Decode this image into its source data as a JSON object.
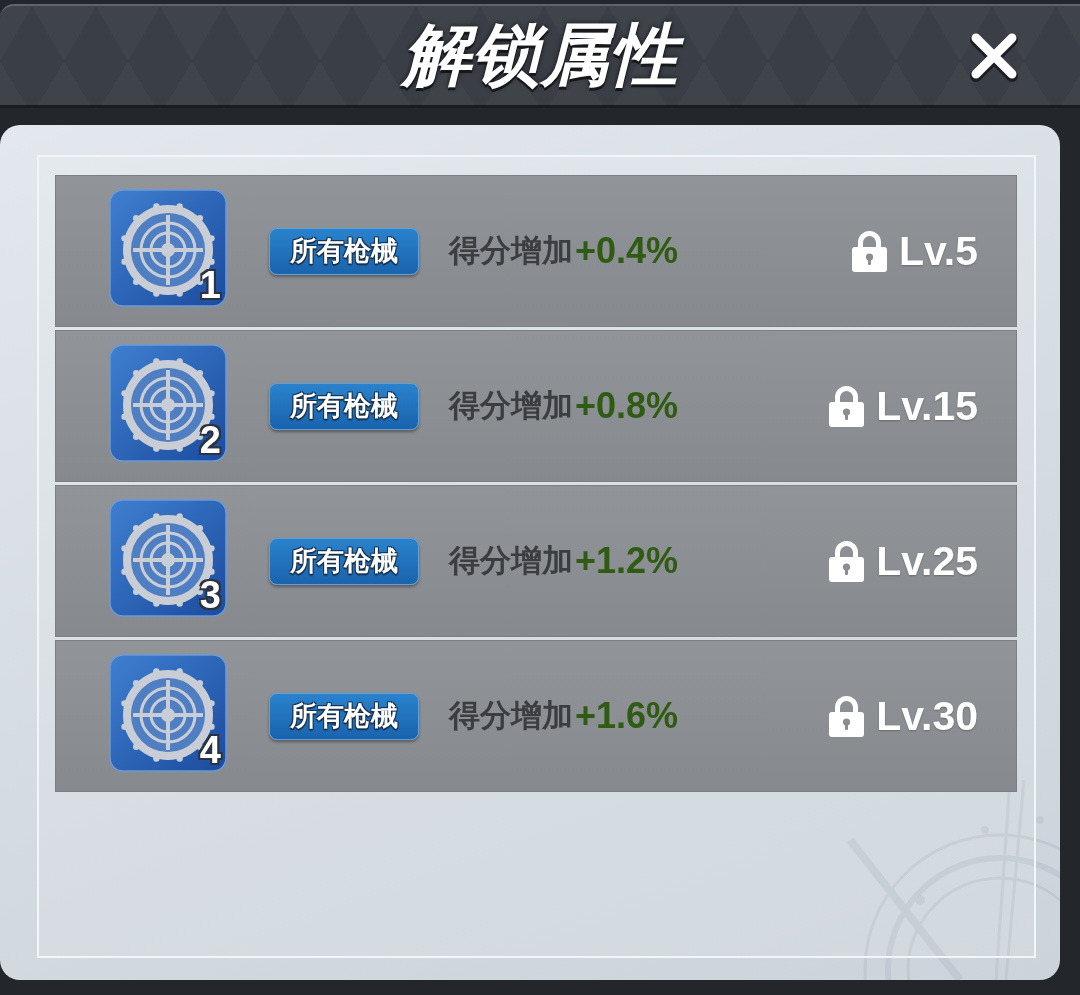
{
  "title_bar": {
    "title": "解锁属性"
  },
  "attributes": [
    {
      "tier": "1",
      "scope": "所有枪械",
      "effect_label": "得分增加",
      "effect_value": "+0.4%",
      "locked": true,
      "unlock_level": "Lv.5"
    },
    {
      "tier": "2",
      "scope": "所有枪械",
      "effect_label": "得分增加",
      "effect_value": "+0.8%",
      "locked": true,
      "unlock_level": "Lv.15"
    },
    {
      "tier": "3",
      "scope": "所有枪械",
      "effect_label": "得分增加",
      "effect_value": "+1.2%",
      "locked": true,
      "unlock_level": "Lv.25"
    },
    {
      "tier": "4",
      "scope": "所有枪械",
      "effect_label": "得分增加",
      "effect_value": "+1.6%",
      "locked": true,
      "unlock_level": "Lv.30"
    }
  ]
}
